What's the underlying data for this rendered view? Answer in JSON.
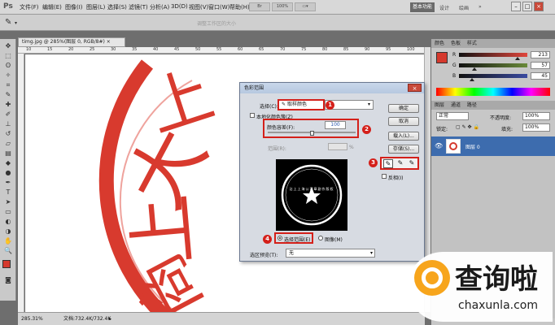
{
  "menubar": {
    "items": [
      "文件(F)",
      "编辑(E)",
      "图像(I)",
      "图层(L)",
      "选择(S)",
      "滤镜(T)",
      "分析(A)",
      "3D(D)",
      "视图(V)",
      "窗口(W)",
      "帮助(H)"
    ],
    "zoom": "100%",
    "workspaces": [
      "基本功能",
      "设计",
      "绘画"
    ]
  },
  "optbar": {
    "faded_label": "调整工作区的大小"
  },
  "document": {
    "tab": "timg.jpg @ 285%(图层 0, RGB/8#) ×",
    "zoom_status": "285.31%",
    "doc_status": "文档:732.4K/732.4K"
  },
  "ruler": {
    "top_ticks": [
      "10",
      "15",
      "20",
      "25",
      "30",
      "35",
      "40",
      "45",
      "50",
      "55",
      "60",
      "65",
      "70",
      "75",
      "80",
      "85",
      "90",
      "95",
      "100"
    ]
  },
  "color_panel": {
    "tabs": [
      "颜色",
      "色板",
      "样式"
    ],
    "sliders": [
      {
        "label": "R",
        "value": "213",
        "fill": 0.84,
        "track": "#e0463c"
      },
      {
        "label": "G",
        "value": "57",
        "fill": 0.22,
        "track": "#6a8a3a"
      },
      {
        "label": "B",
        "value": "45",
        "fill": 0.18,
        "track": "#3a4aa0"
      }
    ],
    "foreground": "#d5392d"
  },
  "layers_panel": {
    "tabs": [
      "图层",
      "通道",
      "路径"
    ],
    "blend_mode": "正常",
    "opacity_label": "不透明度:",
    "opacity": "100%",
    "lock_label": "锁定:",
    "fill_label": "填充:",
    "fill": "100%",
    "layer_name": "图层 0"
  },
  "dialog": {
    "title": "色彩范围",
    "select_label": "选择(C):",
    "select_value": "取样颜色",
    "localized_label": "本地化颜色簇(Z)",
    "fuzziness_label": "颜色容差(F):",
    "fuzziness_value": "100",
    "range_label": "范围(R):",
    "range_unit": "%",
    "buttons": {
      "ok": "确定",
      "cancel": "取消",
      "load": "载入(L)...",
      "save": "存储(S)..."
    },
    "invert_label": "反相(I)",
    "radio_selection": "选择范围(E)",
    "radio_image": "图像(M)",
    "preview_label": "选区预览(T):",
    "preview_value": "无",
    "preview_text": "沾上上海公司章副作版权",
    "badges": [
      "1",
      "2",
      "3",
      "4"
    ]
  },
  "watermark": {
    "title": "查询啦",
    "url": "chaxunla.com"
  },
  "stamp_chars": [
    "上",
    "大",
    "上",
    "商",
    "啦"
  ]
}
